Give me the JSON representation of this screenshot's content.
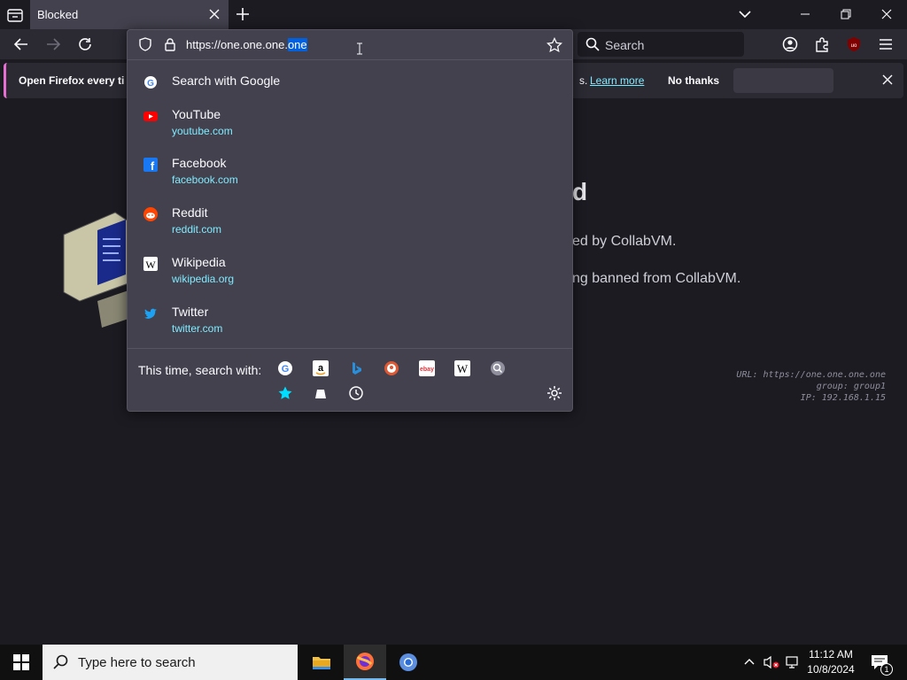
{
  "tab": {
    "title": "Blocked"
  },
  "navbar": {
    "search_placeholder": "Search"
  },
  "urlbar": {
    "url_prefix": "https://one.one.one.",
    "url_selected": "one"
  },
  "notification": {
    "text": "Open Firefox every ti",
    "tail": "s.",
    "learn_more": "Learn more",
    "no_thanks": "No thanks"
  },
  "suggestions": [
    {
      "title": "Search with Google",
      "sub": "",
      "icon": "google-icon"
    },
    {
      "title": "YouTube",
      "sub": "youtube.com",
      "icon": "youtube-icon"
    },
    {
      "title": "Facebook",
      "sub": "facebook.com",
      "icon": "facebook-icon"
    },
    {
      "title": "Reddit",
      "sub": "reddit.com",
      "icon": "reddit-icon"
    },
    {
      "title": "Wikipedia",
      "sub": "wikipedia.org",
      "icon": "wikipedia-icon"
    },
    {
      "title": "Twitter",
      "sub": "twitter.com",
      "icon": "twitter-icon"
    }
  ],
  "one_off": {
    "label": "This time, search with:",
    "engines": [
      "google-icon",
      "amazon-icon",
      "bing-icon",
      "duckduckgo-icon",
      "ebay-icon",
      "wikipedia-icon",
      "search-icon"
    ],
    "modes": [
      "bookmarks-icon",
      "tabs-icon",
      "history-icon"
    ]
  },
  "page": {
    "heading_fragment": "d",
    "line1": "ed by CollabVM.",
    "line2": "ng banned from CollabVM.",
    "meta": [
      "URL: https://one.one.one.one",
      "group: group1",
      "IP: 192.168.1.15"
    ]
  },
  "taskbar": {
    "search_placeholder": "Type here to search",
    "time": "11:12 AM",
    "date": "10/8/2024",
    "notification_count": "1"
  },
  "colors": {
    "accent": "#0060df",
    "link": "#80ebff",
    "notif_stripe": "#e66fd1"
  }
}
